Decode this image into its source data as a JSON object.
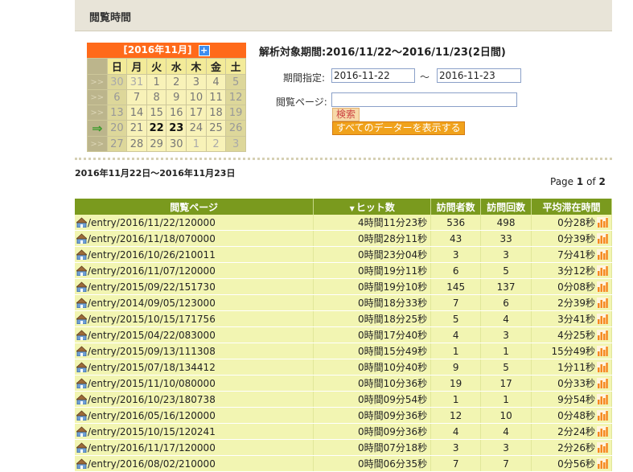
{
  "header": {
    "title": "閲覧時間"
  },
  "calendar": {
    "month_label": "[2016年11月]",
    "expand_icon": "plus-icon",
    "weekdays": [
      "日",
      "月",
      "火",
      "水",
      "木",
      "金",
      "土"
    ],
    "weeks": [
      {
        "arrow": ">>",
        "days": [
          "30",
          "31",
          "1",
          "2",
          "3",
          "4",
          "5"
        ]
      },
      {
        "arrow": ">>",
        "days": [
          "6",
          "7",
          "8",
          "9",
          "10",
          "11",
          "12"
        ]
      },
      {
        "arrow": ">>",
        "days": [
          "13",
          "14",
          "15",
          "16",
          "17",
          "18",
          "19"
        ]
      },
      {
        "arrow": "⇒",
        "days": [
          "20",
          "21",
          "22",
          "23",
          "24",
          "25",
          "26"
        ]
      },
      {
        "arrow": ">>",
        "days": [
          "27",
          "28",
          "29",
          "30",
          "1",
          "2",
          "3"
        ]
      }
    ]
  },
  "analysis_period": "解析対象期間:2016/11/22〜2016/11/23(2日間)",
  "form": {
    "period_label": "期間指定:",
    "start_date": "2016-11-22",
    "tilde": "〜",
    "end_date": "2016-11-23",
    "page_label": "閲覧ページ:",
    "page_value": "",
    "search_button": "検索",
    "show_all_button": "すべてのデーターを表示する"
  },
  "range_label": "2016年11月22日〜2016年11月23日",
  "pagination": {
    "prefix": "Page",
    "current": "1",
    "of": "of",
    "total": "2"
  },
  "table": {
    "headers": [
      "閲覧ページ",
      "ヒット数",
      "訪問者数",
      "訪問回数",
      "平均滞在時間"
    ],
    "rows": [
      {
        "page": "/entry/2016/11/22/120000",
        "hits": "4時間11分23秒",
        "visitors": "536",
        "visits": "498",
        "avg": "0分28秒"
      },
      {
        "page": "/entry/2016/11/18/070000",
        "hits": "0時間28分11秒",
        "visitors": "43",
        "visits": "33",
        "avg": "0分39秒"
      },
      {
        "page": "/entry/2016/10/26/210011",
        "hits": "0時間23分04秒",
        "visitors": "3",
        "visits": "3",
        "avg": "7分41秒"
      },
      {
        "page": "/entry/2016/11/07/120000",
        "hits": "0時間19分11秒",
        "visitors": "6",
        "visits": "5",
        "avg": "3分12秒"
      },
      {
        "page": "/entry/2015/09/22/151730",
        "hits": "0時間19分10秒",
        "visitors": "145",
        "visits": "137",
        "avg": "0分08秒"
      },
      {
        "page": "/entry/2014/09/05/123000",
        "hits": "0時間18分33秒",
        "visitors": "7",
        "visits": "6",
        "avg": "2分39秒"
      },
      {
        "page": "/entry/2015/10/15/171756",
        "hits": "0時間18分25秒",
        "visitors": "5",
        "visits": "4",
        "avg": "3分41秒"
      },
      {
        "page": "/entry/2015/04/22/083000",
        "hits": "0時間17分40秒",
        "visitors": "4",
        "visits": "3",
        "avg": "4分25秒"
      },
      {
        "page": "/entry/2015/09/13/111308",
        "hits": "0時間15分49秒",
        "visitors": "1",
        "visits": "1",
        "avg": "15分49秒"
      },
      {
        "page": "/entry/2015/07/18/134412",
        "hits": "0時間10分40秒",
        "visitors": "9",
        "visits": "5",
        "avg": "1分11秒"
      },
      {
        "page": "/entry/2015/11/10/080000",
        "hits": "0時間10分36秒",
        "visitors": "19",
        "visits": "17",
        "avg": "0分33秒"
      },
      {
        "page": "/entry/2016/10/23/180738",
        "hits": "0時間09分54秒",
        "visitors": "1",
        "visits": "1",
        "avg": "9分54秒"
      },
      {
        "page": "/entry/2016/05/16/120000",
        "hits": "0時間09分36秒",
        "visitors": "12",
        "visits": "10",
        "avg": "0分48秒"
      },
      {
        "page": "/entry/2015/10/15/120241",
        "hits": "0時間09分36秒",
        "visitors": "4",
        "visits": "4",
        "avg": "2分24秒"
      },
      {
        "page": "/entry/2016/11/17/120000",
        "hits": "0時間07分18秒",
        "visitors": "3",
        "visits": "3",
        "avg": "2分26秒"
      },
      {
        "page": "/entry/2016/08/02/210000",
        "hits": "0時間06分35秒",
        "visitors": "7",
        "visits": "7",
        "avg": "0分56秒"
      }
    ]
  },
  "colors": {
    "header_bg": "#7a9a1e",
    "row_bg": "#f2f5b2",
    "accent": "#ff6a1a",
    "button": "#f0a21c"
  }
}
